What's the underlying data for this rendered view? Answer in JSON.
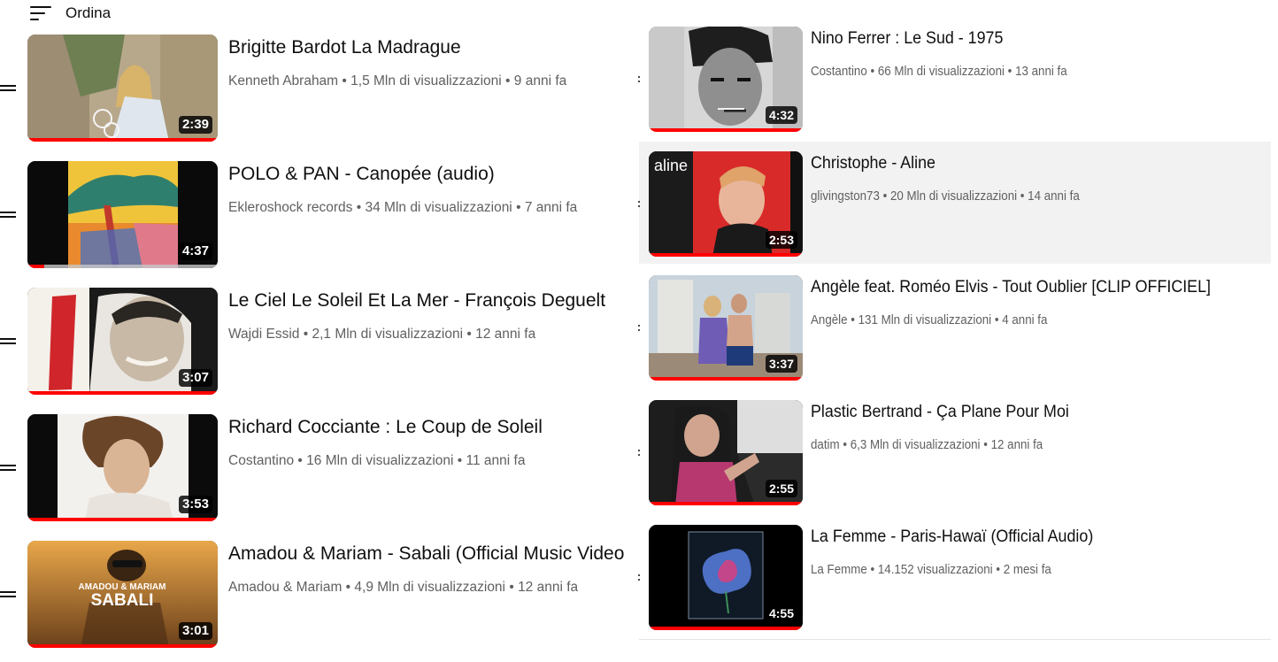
{
  "sort": {
    "label": "Ordina",
    "icon": "sort-icon"
  },
  "left_videos": [
    {
      "title": "Brigitte Bardot La Madrague",
      "channel": "Kenneth Abraham",
      "views": "1,5 Mln di visualizzazioni",
      "age": "9 anni fa",
      "duration": "2:39",
      "watched": 1.0
    },
    {
      "title": "POLO & PAN - Canopée (audio)",
      "channel": "Ekleroshock records",
      "views": "34 Mln di visualizzazioni",
      "age": "7 anni fa",
      "duration": "4:37",
      "watched": 0.09
    },
    {
      "title": "Le Ciel Le Soleil Et La Mer - François Deguelt",
      "channel": "Wajdi Essid",
      "views": "2,1 Mln di visualizzazioni",
      "age": "12 anni fa",
      "duration": "3:07",
      "watched": 1.0
    },
    {
      "title": "Richard Cocciante : Le Coup de Soleil",
      "channel": "Costantino",
      "views": "16 Mln di visualizzazioni",
      "age": "11 anni fa",
      "duration": "3:53",
      "watched": 1.0
    },
    {
      "title": "Amadou & Mariam - Sabali (Official Music Video",
      "channel": "Amadou & Mariam",
      "views": "4,9 Mln di visualizzazioni",
      "age": "12 anni fa",
      "duration": "3:01",
      "watched": 1.0,
      "thumb_text_top": "AMADOU & MARIAM",
      "thumb_text_main": "SABALI"
    }
  ],
  "right_videos": [
    {
      "title": "Nino Ferrer : Le Sud - 1975",
      "channel": "Costantino",
      "views": "66 Mln di visualizzazioni",
      "age": "13 anni fa",
      "duration": "4:32",
      "watched": 1.0
    },
    {
      "title": "Christophe - Aline",
      "channel": "glivingston73",
      "views": "20 Mln di visualizzazioni",
      "age": "14 anni fa",
      "duration": "2:53",
      "watched": 1.0,
      "thumb_text": "aline"
    },
    {
      "title": "Angèle feat. Roméo Elvis - Tout Oublier [CLIP OFFICIEL]",
      "channel": "Angèle",
      "views": "131 Mln di visualizzazioni",
      "age": "4 anni fa",
      "duration": "3:37",
      "watched": 1.0
    },
    {
      "title": "Plastic Bertrand - Ça Plane Pour Moi",
      "channel": "datim",
      "views": "6,3 Mln di visualizzazioni",
      "age": "12 anni fa",
      "duration": "2:55",
      "watched": 1.0
    },
    {
      "title": "La Femme - Paris-Hawaï (Official Audio)",
      "channel": "La Femme",
      "views": "14.152 visualizzazioni",
      "age": "2 mesi fa",
      "duration": "4:55",
      "watched": 1.0
    }
  ],
  "separator": "•",
  "colors": {
    "progress": "#ff0000",
    "meta_text": "#606060",
    "hover_bg": "#f2f2f2"
  }
}
